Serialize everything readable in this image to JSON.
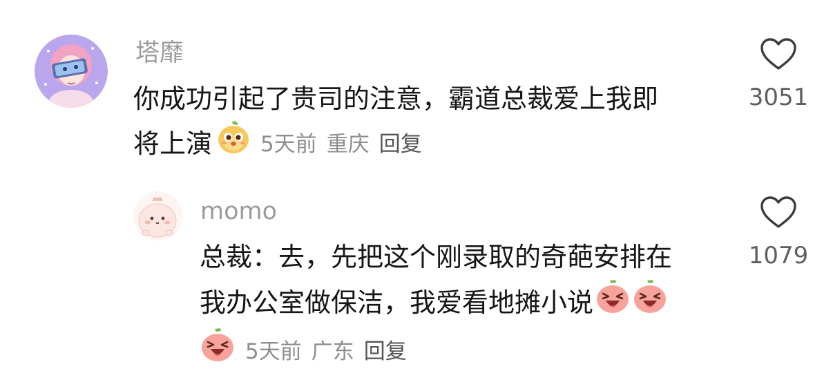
{
  "comments": [
    {
      "username": "塔靡",
      "text_line1": "你成功引起了贵司的注意，霸道总裁爱上我即",
      "text_line2": "将上演",
      "time": "5天前",
      "location": "重庆",
      "reply_label": "回复",
      "like_count": "3051",
      "emoji": "chick-emoji"
    },
    {
      "username": "momo",
      "text_line1": "总裁：去，先把这个刚录取的奇葩安排在",
      "text_line2": "我办公室做保洁，我爱看地摊小说",
      "time": "5天前",
      "location": "广东",
      "reply_label": "回复",
      "like_count": "1079",
      "emoji": "laughing-peach-emoji"
    }
  ],
  "colors": {
    "username": "#9b9b9b",
    "text": "#161616",
    "meta": "#8e8e8e",
    "like": "#5e5e5e"
  }
}
